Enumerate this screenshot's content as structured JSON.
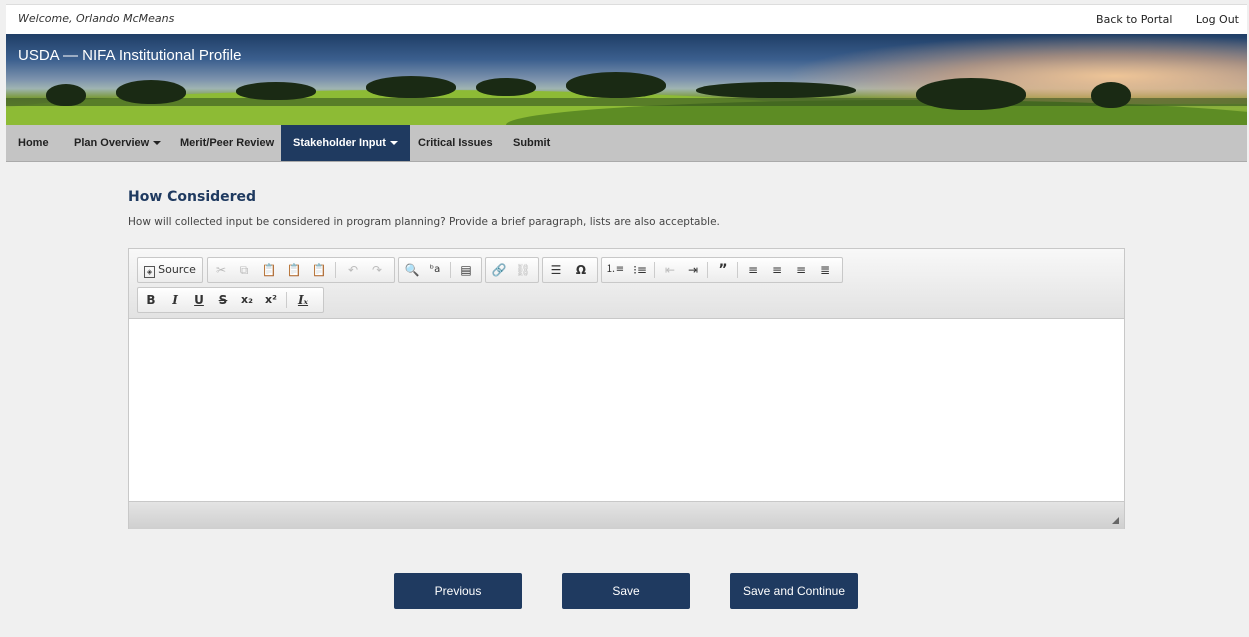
{
  "header": {
    "welcome": "Welcome, Orlando McMeans",
    "back_to_portal": "Back to Portal",
    "log_out": "Log Out"
  },
  "banner": {
    "title": "USDA — NIFA Institutional Profile"
  },
  "nav": {
    "home": "Home",
    "plan_overview": "Plan Overview",
    "merit_peer_review": "Merit/Peer Review",
    "stakeholder_input": "Stakeholder Input",
    "critical_issues": "Critical Issues",
    "submit": "Submit",
    "active": "Stakeholder Input"
  },
  "section": {
    "heading": "How Considered",
    "description": "How will collected input be considered in program planning? Provide a brief paragraph, lists are also acceptable."
  },
  "editor": {
    "source_label": "Source",
    "content": "",
    "toolbar_row1": [
      "source",
      "cut",
      "copy",
      "paste",
      "paste-text",
      "paste-word",
      "undo",
      "redo",
      "find",
      "replace",
      "select-all",
      "link",
      "unlink",
      "horizontal-line",
      "special-char",
      "numbered-list",
      "bulleted-list",
      "outdent",
      "indent",
      "blockquote",
      "align-left",
      "align-center",
      "align-right",
      "justify"
    ],
    "toolbar_row2": [
      "bold",
      "italic",
      "underline",
      "strike",
      "subscript",
      "superscript",
      "remove-format"
    ]
  },
  "actions": {
    "previous": "Previous",
    "save": "Save",
    "save_and_continue": "Save and Continue"
  },
  "colors": {
    "nav_active": "#1f3a60",
    "button": "#1f3a60",
    "heading": "#1f3a60"
  }
}
